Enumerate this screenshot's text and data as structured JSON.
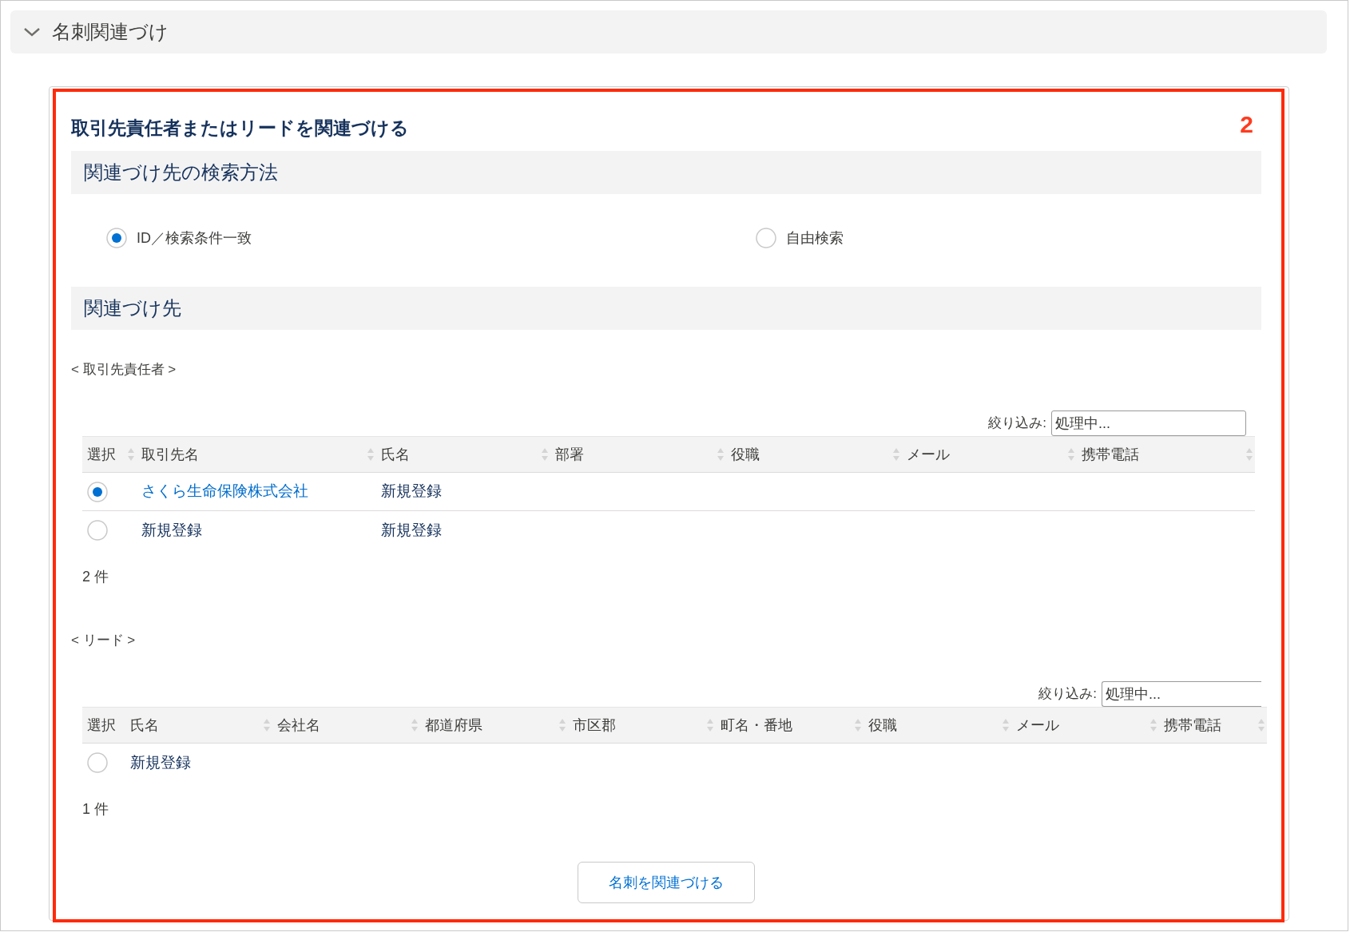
{
  "section_header": {
    "title": "名刺関連づけ",
    "expanded": true
  },
  "card": {
    "title": "取引先責任者またはリードを関連づける",
    "annotation": "2",
    "search_method": {
      "heading": "関連づけ先の検索方法",
      "options": [
        {
          "label": "ID／検索条件一致",
          "selected": true
        },
        {
          "label": "自由検索",
          "selected": false
        }
      ]
    },
    "targets_heading": "関連づけ先",
    "tables": [
      {
        "caption": "< 取引先責任者 >",
        "filter_label": "絞り込み:",
        "filter_value": "処理中...",
        "columns": [
          {
            "label": "選択",
            "sortable": true
          },
          {
            "label": "取引先名",
            "sortable": true
          },
          {
            "label": "氏名",
            "sortable": true
          },
          {
            "label": "部署",
            "sortable": true
          },
          {
            "label": "役職",
            "sortable": true
          },
          {
            "label": "メール",
            "sortable": true
          },
          {
            "label": "携帯電話",
            "sortable": true
          }
        ],
        "rows": [
          {
            "selected": true,
            "cells": [
              {
                "kind": "radio"
              },
              {
                "text": "さくら生命保険株式会社",
                "kind": "link"
              },
              {
                "text": "新規登録",
                "kind": "text"
              }
            ]
          },
          {
            "selected": false,
            "cells": [
              {
                "kind": "radio"
              },
              {
                "text": "新規登録",
                "kind": "text"
              },
              {
                "text": "新規登録",
                "kind": "text"
              }
            ]
          }
        ],
        "count": "2 件"
      },
      {
        "caption": "< リード >",
        "filter_label": "絞り込み:",
        "filter_value": "処理中...",
        "columns": [
          {
            "label": "選択",
            "sortable": false
          },
          {
            "label": "氏名",
            "sortable": true
          },
          {
            "label": "会社名",
            "sortable": true
          },
          {
            "label": "都道府県",
            "sortable": true
          },
          {
            "label": "市区郡",
            "sortable": true
          },
          {
            "label": "町名・番地",
            "sortable": true
          },
          {
            "label": "役職",
            "sortable": true
          },
          {
            "label": "メール",
            "sortable": true
          },
          {
            "label": "携帯電話",
            "sortable": true
          }
        ],
        "rows": [
          {
            "selected": false,
            "cells": [
              {
                "kind": "radio"
              },
              {
                "text": "新規登録",
                "kind": "text"
              }
            ]
          }
        ],
        "count": "1 件"
      }
    ],
    "button": "名刺を関連づける"
  }
}
